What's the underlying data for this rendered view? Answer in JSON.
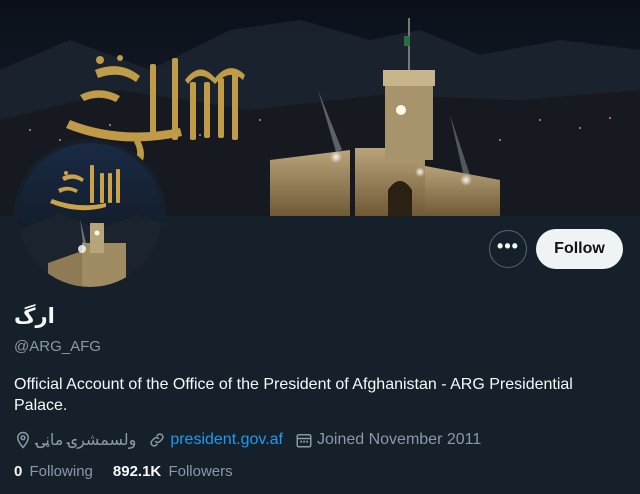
{
  "profile": {
    "display_name": "ارگ",
    "handle": "@ARG_AFG",
    "bio": "Official Account of the Office of the President of Afghanistan - ARG Presidential Palace.",
    "location": "ولسمشرۍ ماڼۍ",
    "website": "president.gov.af",
    "joined": "Joined November 2011",
    "following_count": "0",
    "following_label": "Following",
    "followers_count": "892.1K",
    "followers_label": "Followers"
  },
  "actions": {
    "more_label": "•••",
    "follow_label": "Follow"
  },
  "icons": {
    "more": "more-dots-icon",
    "location": "location-pin-icon",
    "link": "link-icon",
    "calendar": "calendar-icon"
  },
  "colors": {
    "background": "#15202b",
    "text": "#f7f9f9",
    "muted": "#8b98a5",
    "link": "#1d9bf0",
    "follow_button": "#eff3f4",
    "gold": "#c9a24a"
  }
}
